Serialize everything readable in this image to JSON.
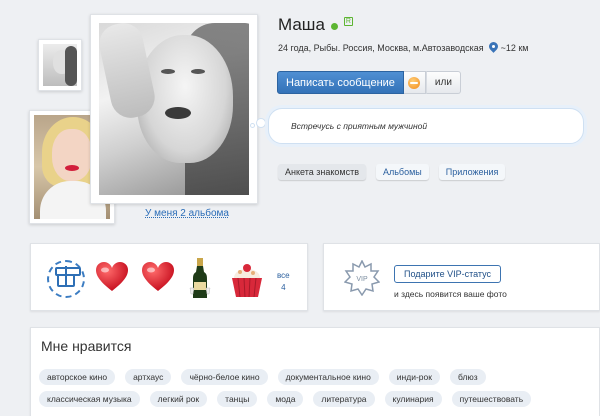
{
  "profile": {
    "name": "Маша",
    "badge": "R",
    "info": "24 года, Рыбы. Россия, Москва, м.Автозаводская",
    "distance": "~12 км",
    "albums_link": "У меня 2 альбома",
    "status": "Встречусь с приятным мужчиной",
    "online_color": "#5cb531"
  },
  "actions": {
    "write_message": "Написать сообщение",
    "or": "или"
  },
  "tabs": [
    {
      "label": "Анкета знакомств",
      "active": true
    },
    {
      "label": "Альбомы",
      "active": false
    },
    {
      "label": "Приложения",
      "active": false
    }
  ],
  "gifts": {
    "items": [
      "gift-add-icon",
      "heart-icon",
      "heart-icon",
      "champagne-icon",
      "cupcake-icon"
    ],
    "all_label": "все",
    "all_count": "4"
  },
  "vip": {
    "badge_text": "VIP",
    "button": "Подарите VIP-статус",
    "note": "и здесь появится ваше фото"
  },
  "likes": {
    "title": "Мне нравится",
    "tags": [
      "авторское кино",
      "артхаус",
      "чёрно-белое кино",
      "документальное кино",
      "инди-рок",
      "блюз",
      "классическая музыка",
      "легкий рок",
      "танцы",
      "мода",
      "литература",
      "кулинария",
      "путешествовать"
    ]
  },
  "colors": {
    "primary": "#3372b8",
    "link": "#2a6db8",
    "heart": "#e5202c"
  }
}
